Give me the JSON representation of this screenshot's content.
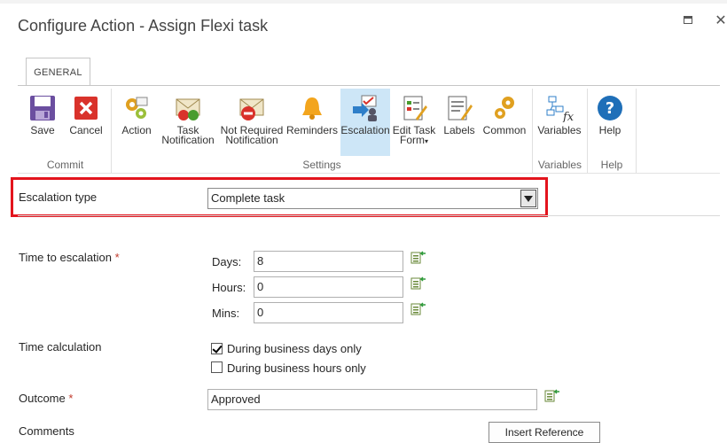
{
  "dialog": {
    "title": "Configure Action - Assign Flexi task"
  },
  "ribbon": {
    "tab": "GENERAL",
    "buttons": {
      "save": "Save",
      "cancel": "Cancel",
      "action": "Action",
      "task_notification_1": "Task",
      "task_notification_2": "Notification",
      "not_required_1": "Not Required",
      "not_required_2": "Notification",
      "reminders": "Reminders",
      "escalation": "Escalation",
      "edit_task_form_1": "Edit Task",
      "edit_task_form_2": "Form",
      "labels": "Labels",
      "common": "Common",
      "variables": "Variables",
      "help": "Help"
    },
    "groups": {
      "commit": "Commit",
      "settings": "Settings",
      "variables": "Variables",
      "help": "Help"
    }
  },
  "form": {
    "escalation_type": {
      "label": "Escalation type",
      "value": "Complete task"
    },
    "time_to_escalation": {
      "label": "Time to escalation",
      "required": "*",
      "days_label": "Days:",
      "days": "8",
      "hours_label": "Hours:",
      "hours": "0",
      "mins_label": "Mins:",
      "mins": "0"
    },
    "time_calculation": {
      "label": "Time calculation",
      "business_days": "During business days only",
      "business_days_checked": true,
      "business_hours": "During business hours only",
      "business_hours_checked": false
    },
    "outcome": {
      "label": "Outcome",
      "required": "*",
      "value": "Approved"
    },
    "comments": {
      "label": "Comments",
      "insert_reference": "Insert Reference"
    }
  },
  "colors": {
    "highlight_border": "#e3141d",
    "active_button": "#cde6f7"
  }
}
